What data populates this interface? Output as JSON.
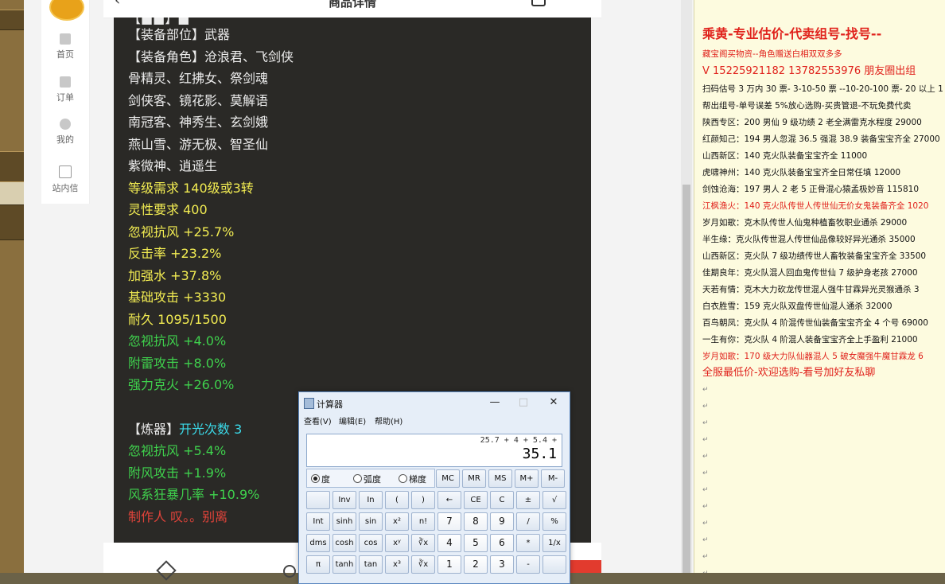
{
  "page": {
    "title": "商品详情"
  },
  "side_nav": {
    "items": [
      {
        "label": "首页"
      },
      {
        "label": "订单"
      },
      {
        "label": "我的"
      },
      {
        "label": "站内信"
      }
    ]
  },
  "item_panel": {
    "lines": [
      {
        "text": "【装备部位】武器",
        "color": "white"
      },
      {
        "text": "【装备角色】沧浪君、飞剑侠",
        "color": "white"
      },
      {
        "text": "骨精灵、红拂女、祭剑魂",
        "color": "white"
      },
      {
        "text": "剑侠客、镜花影、莫解语",
        "color": "white"
      },
      {
        "text": "南冠客、神秀生、玄剑娥",
        "color": "white"
      },
      {
        "text": "燕山雪、游无极、智圣仙",
        "color": "white"
      },
      {
        "text": "紫微神、逍遥生",
        "color": "white"
      },
      {
        "text": "等级需求 140级或3转",
        "color": "yellow"
      },
      {
        "text": "灵性要求 400",
        "color": "yellow"
      },
      {
        "text": "忽视抗风 +25.7%",
        "color": "yellow"
      },
      {
        "text": "反击率 +23.2%",
        "color": "yellow"
      },
      {
        "text": "加强水 +37.8%",
        "color": "yellow"
      },
      {
        "text": "基础攻击 +3330",
        "color": "yellow"
      },
      {
        "text": "耐久 1095/1500",
        "color": "yellow"
      },
      {
        "text": "忽视抗风 +4.0%",
        "color": "green"
      },
      {
        "text": "附雷攻击 +8.0%",
        "color": "green"
      },
      {
        "text": "强力克火 +26.0%",
        "color": "green"
      }
    ],
    "lian_label": "【炼器】",
    "lian_value": "开光次数 3",
    "lian_lines": [
      {
        "text": "忽视抗风 +5.4%",
        "color": "green"
      },
      {
        "text": "附风攻击 +1.9%",
        "color": "green"
      },
      {
        "text": "风系狂暴几率 +10.9%",
        "color": "green"
      }
    ],
    "maker": "制作人 叹。。别离"
  },
  "calculator": {
    "title": "计算器",
    "menus": [
      "查看(V)",
      "编辑(E)",
      "帮助(H)"
    ],
    "expression": "25.7 + 4 + 5.4 +",
    "result": "35.1",
    "angle_modes": [
      "度",
      "弧度",
      "梯度"
    ],
    "selected_angle": "度",
    "memory_keys": [
      "MC",
      "MR",
      "MS",
      "M+",
      "M-"
    ],
    "rows": [
      [
        "",
        "Inv",
        "In",
        "(",
        ")",
        "←",
        "CE",
        "C",
        "±",
        "√"
      ],
      [
        "Int",
        "sinh",
        "sin",
        "x²",
        "n!",
        "7",
        "8",
        "9",
        "/",
        "%"
      ],
      [
        "dms",
        "cosh",
        "cos",
        "xʸ",
        "∛x",
        "4",
        "5",
        "6",
        "*",
        "1/x"
      ],
      [
        "π",
        "tanh",
        "tan",
        "x³",
        "∛x",
        "1",
        "2",
        "3",
        "-",
        ""
      ]
    ]
  },
  "doc": {
    "heading": "乘黄-专业估价-代卖组号-找号--",
    "lines": [
      {
        "text": "藏宝阁买物资--角色赠送白相双双多多",
        "red": true
      },
      {
        "text": "V 15225921182      13782553976 朋友圈出组",
        "red": true,
        "big": true
      },
      {
        "text": "扫码估号 3 万内 30 票- 3-10-50 票 --10-20-100 票- 20 以上 1",
        "red": false
      },
      {
        "text": "帮出组号-单号误差 5%放心选购-买贵管退-不玩免费代卖",
        "red": false
      },
      {
        "text": "陕西专区：200 男仙 9 级功绩 2 老全满雷克水程度 29000",
        "red": false
      },
      {
        "text": "红颜知己：194 男人忽混 36.5 强混 38.9 装备宝宝齐全 27000",
        "red": false
      },
      {
        "text": "山西新区：140 克火队装备宝宝齐全 11000",
        "red": false
      },
      {
        "text": "虎啸神州：140 克火队装备宝宝齐全日常任填 12000",
        "red": false
      },
      {
        "text": "剑蚀沧海：197 男人 2 老 5 正骨混心猿孟极妙音 115810",
        "red": false
      },
      {
        "text": "江枫渔火：140 克火队传世人传世仙无价女鬼装备齐全 1020",
        "red": true
      },
      {
        "text": "岁月如歌：克木队传世人仙鬼种植畜牧职业通杀 29000",
        "red": false
      },
      {
        "text": "半生缘：克火队传世混人传世仙品像较好异光通杀 35000",
        "red": false
      },
      {
        "text": "山西新区：克火队 7 级功绩传世人畜牧装备宝宝齐全 33500",
        "red": false
      },
      {
        "text": "佳期良年：克火队混人回血鬼传世仙 7 级护身老孩 27000",
        "red": false
      },
      {
        "text": "天若有情：克木大力砍龙传世混人强牛甘霖异光灵猴通杀 3",
        "red": false
      },
      {
        "text": "白衣胜雪：159 克火队双盘传世仙混人通杀 32000",
        "red": false
      },
      {
        "text": "百鸟朝凤：克火队 4 阶混传世仙装备宝宝齐全 4 个号 69000",
        "red": false
      },
      {
        "text": "一生有你：克火队 4 阶混人装备宝宝齐全上手盈利 21000",
        "red": false
      },
      {
        "text": "岁月如歌：170 级大力队仙器混人 5 破女魔强牛魔甘霖龙 6",
        "red": true
      },
      {
        "text": "全服最低价-欢迎选购-看号加好友私聊",
        "red": true,
        "big": true
      }
    ]
  },
  "colors": {
    "panel_bg": "#2a2926",
    "yellow": "#f2ec52",
    "green": "#3fd14d",
    "red": "#e0433a",
    "cyan": "#3bd9e8"
  }
}
